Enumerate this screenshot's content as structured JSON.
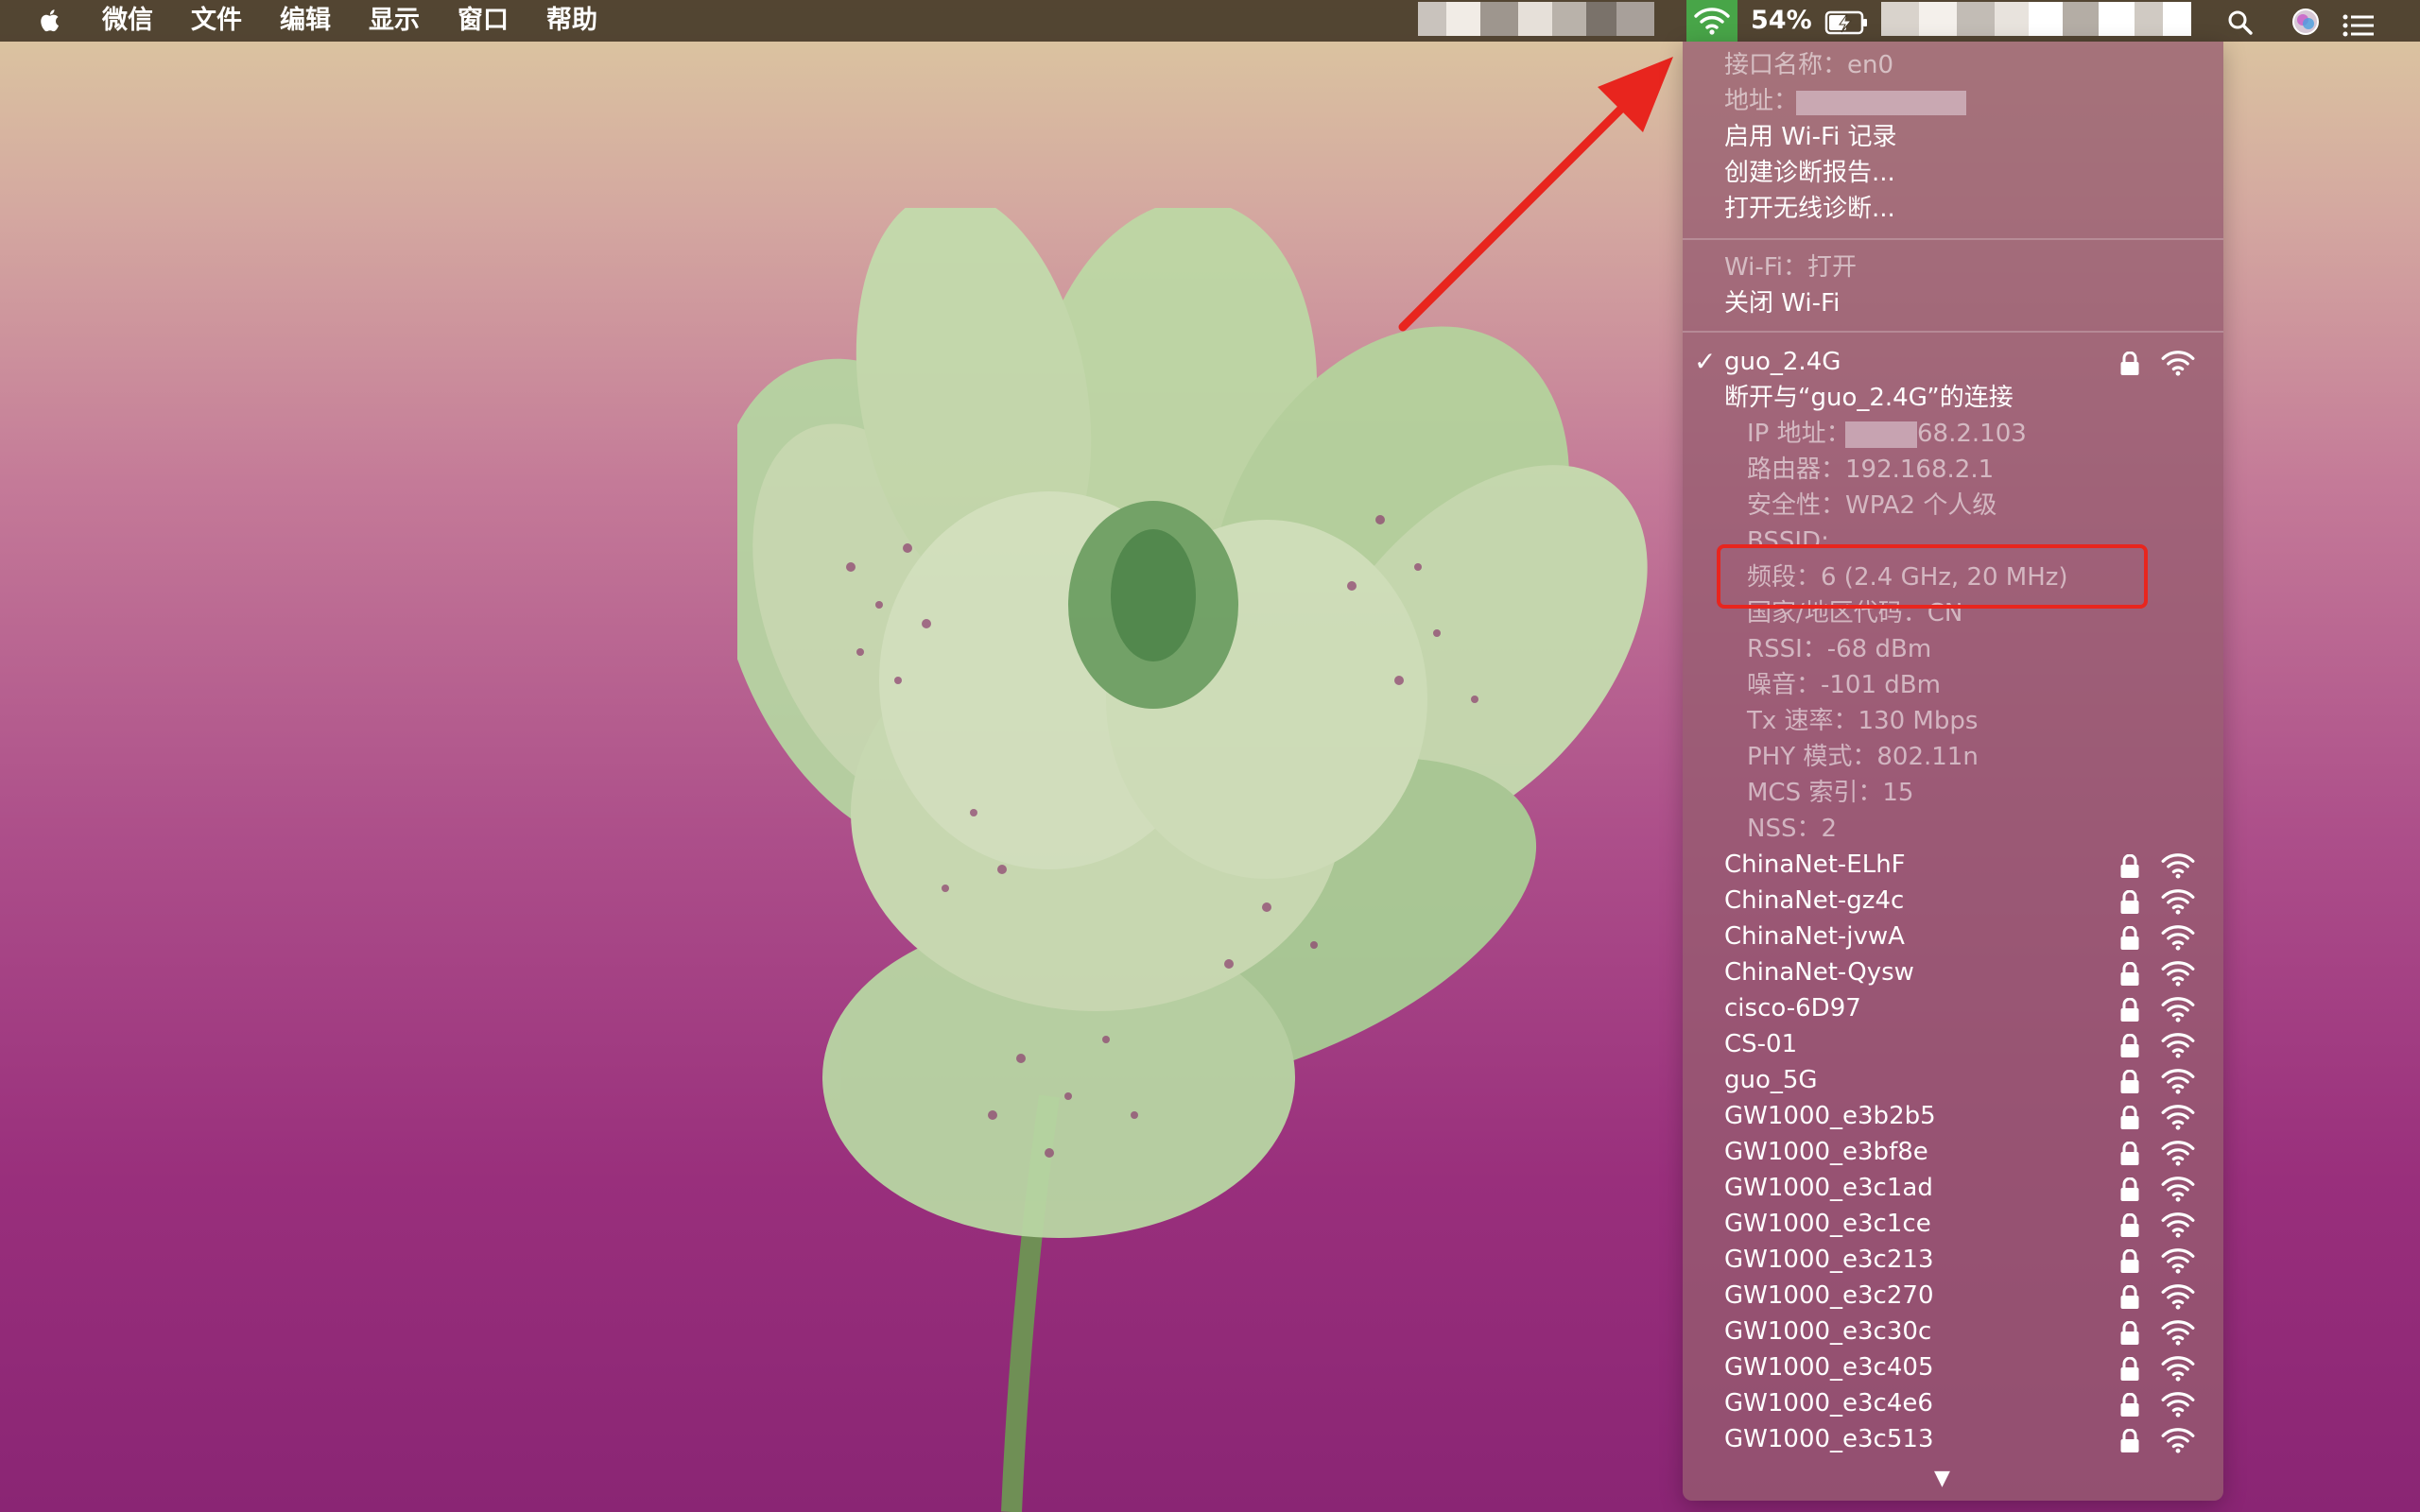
{
  "menubar": {
    "app_name": "微信",
    "menus": [
      "文件",
      "编辑",
      "显示",
      "窗口",
      "帮助"
    ],
    "battery_percent": "54%"
  },
  "wifi_menu": {
    "interface": {
      "name_label": "接口名称：en0",
      "address_label": "地址：",
      "enable_logging": "启用 Wi-Fi 记录",
      "create_report": "创建诊断报告...",
      "open_diagnostics": "打开无线诊断..."
    },
    "wifi_power": {
      "status": "Wi-Fi：打开",
      "toggle": "关闭 Wi-Fi"
    },
    "connected": {
      "ssid": "guo_2.4G",
      "disconnect": "断开与“guo_2.4G”的连接",
      "details": [
        "IP 地址：",
        "68.2.103",
        "路由器：192.168.2.1",
        "安全性：WPA2 个人级",
        "BSSID:",
        "频段：6 (2.4 GHz, 20 MHz)",
        "国家/地区代码：CN",
        "RSSI：-68 dBm",
        "噪音：-101 dBm",
        "Tx 速率：130 Mbps",
        "PHY 模式：802.11n",
        "MCS 索引：15",
        "NSS：2"
      ]
    },
    "networks": [
      "ChinaNet-ELhF",
      "ChinaNet-gz4c",
      "ChinaNet-jvwA",
      "ChinaNet-Qysw",
      "cisco-6D97",
      "CS-01",
      "guo_5G",
      "GW1000_e3b2b5",
      "GW1000_e3bf8e",
      "GW1000_e3c1ad",
      "GW1000_e3c1ce",
      "GW1000_e3c213",
      "GW1000_e3c270",
      "GW1000_e3c30c",
      "GW1000_e3c405",
      "GW1000_e3c4e6",
      "GW1000_e3c513"
    ]
  },
  "colors": {
    "wifi_active_bg": "#48a548",
    "annotation_red": "#e8251e"
  }
}
